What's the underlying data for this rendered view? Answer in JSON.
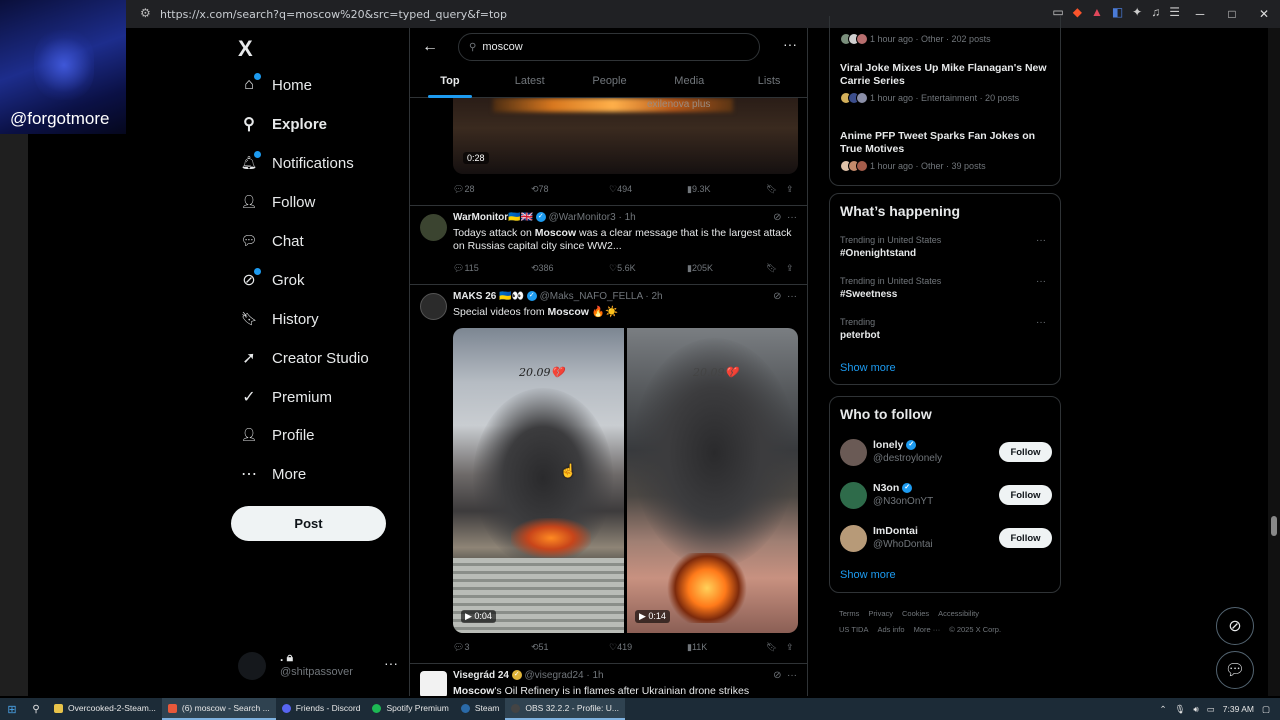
{
  "browser": {
    "url": "https://x.com/search?q=moscow%20&src=typed_query&f=top",
    "controls": [
      "─",
      "□",
      "✕"
    ]
  },
  "overlay": {
    "handle": "@forgotmore"
  },
  "sidebar": {
    "logo": "X",
    "items": [
      {
        "label": "Home",
        "icon": "home-icon",
        "glyph": "⌂"
      },
      {
        "label": "Explore",
        "icon": "search-icon",
        "glyph": "⚲"
      },
      {
        "label": "Notifications",
        "icon": "bell-icon",
        "glyph": "🔔︎"
      },
      {
        "label": "Follow",
        "icon": "person-plus-icon",
        "glyph": "👤︎"
      },
      {
        "label": "Chat",
        "icon": "chat-icon",
        "glyph": "💬︎"
      },
      {
        "label": "Grok",
        "icon": "grok-icon",
        "glyph": "⊘"
      },
      {
        "label": "History",
        "icon": "bookmark-icon",
        "glyph": "🔖︎"
      },
      {
        "label": "Creator Studio",
        "icon": "rocket-icon",
        "glyph": "➚"
      },
      {
        "label": "Premium",
        "icon": "premium-icon",
        "glyph": "✓"
      },
      {
        "label": "Profile",
        "icon": "person-icon",
        "glyph": "👤︎"
      },
      {
        "label": "More",
        "icon": "more-circle-icon",
        "glyph": "⋯"
      }
    ],
    "notifications_badge": "1",
    "post_label": "Post",
    "account": {
      "name": ". 🔒︎",
      "handle": "@shitpassover",
      "more": "···"
    }
  },
  "search": {
    "query": "moscow",
    "tabs": [
      "Top",
      "Latest",
      "People",
      "Media",
      "Lists"
    ],
    "active_tab": "Top",
    "back": "←",
    "more": "···"
  },
  "top_media": {
    "watermark": "exilenova plus",
    "duration": "0:28"
  },
  "tweets": [
    {
      "actions": {
        "replies": "28",
        "reposts": "78",
        "likes": "494",
        "views": "9.3K"
      }
    },
    {
      "name": "WarMonitor🇺🇦🇬🇧",
      "handle": "@WarMonitor3",
      "time": "1h",
      "text_parts": [
        "Todays attack on ",
        "Moscow",
        " was a clear message that is the largest attack on Russias capital city since WW2..."
      ],
      "actions": {
        "replies": "115",
        "reposts": "386",
        "likes": "5.6K",
        "views": "205K"
      },
      "avatar_color": "#3b4430"
    },
    {
      "name": "MAKS 26 🇺🇦👀",
      "handle": "@Maks_NAFO_FELLA",
      "time": "2h",
      "text_parts": [
        "Special videos from ",
        "Moscow",
        " 🔥☀️"
      ],
      "videos": [
        {
          "caption": "20.09💔",
          "duration": "0:04"
        },
        {
          "caption": "20.09💔",
          "duration": "0:14"
        }
      ],
      "actions": {
        "replies": "3",
        "reposts": "51",
        "likes": "419",
        "views": "11K"
      },
      "avatar_color": "#2b2b2b"
    },
    {
      "name": "Visegrád 24",
      "handle": "@visegrad24",
      "time": "1h",
      "text_parts": [
        "Moscow",
        "'s Oil Refinery is in flames after Ukrainian drone strikes"
      ],
      "avatar_color": "#f2f2f2"
    }
  ],
  "right": {
    "news": [
      {
        "meta": "1 hour ago · Other · 202 posts"
      },
      {
        "title": "Viral Joke Mixes Up Mike Flanagan's New Carrie Series",
        "meta": "1 hour ago · Entertainment · 20 posts"
      },
      {
        "title": "Anime PFP Tweet Sparks Fan Jokes on True Motives",
        "meta": "1 hour ago · Other · 39 posts"
      }
    ],
    "happening": {
      "title": "What’s happening",
      "trends": [
        {
          "context": "Trending in United States",
          "topic": "#Onenightstand"
        },
        {
          "context": "Trending in United States",
          "topic": "#Sweetness"
        },
        {
          "context": "Trending",
          "topic": "peterbot"
        }
      ],
      "show_more": "Show more"
    },
    "who_to_follow": {
      "title": "Who to follow",
      "accounts": [
        {
          "name": "lonely",
          "handle": "@destroylonely",
          "verified": true,
          "color": "#6a5a55"
        },
        {
          "name": "N3on",
          "handle": "@N3onOnYT",
          "verified": true,
          "color": "#2e6b4a"
        },
        {
          "name": "ImDontai",
          "handle": "@WhoDontai",
          "verified": false,
          "color": "#b79a78"
        }
      ],
      "follow_label": "Follow",
      "show_more": "Show more"
    },
    "footer": [
      "Terms",
      "Privacy",
      "Cookies",
      "Accessibility",
      "US TIDA",
      "Ads info",
      "More ···",
      "© 2025 X Corp."
    ]
  },
  "taskbar": {
    "apps": [
      {
        "label": "Overcooked-2-Steam...",
        "color": "#e8c34a"
      },
      {
        "label": "(6) moscow - Search ...",
        "color": "#e8583a",
        "active": true
      },
      {
        "label": "Friends - Discord",
        "color": "#5865f2"
      },
      {
        "label": "Spotify Premium",
        "color": "#1db954"
      },
      {
        "label": "Steam",
        "color": "#2a6aa8"
      },
      {
        "label": "OBS 32.2.2 - Profile: U...",
        "color": "#444"
      }
    ],
    "time": "7:39 AM"
  }
}
